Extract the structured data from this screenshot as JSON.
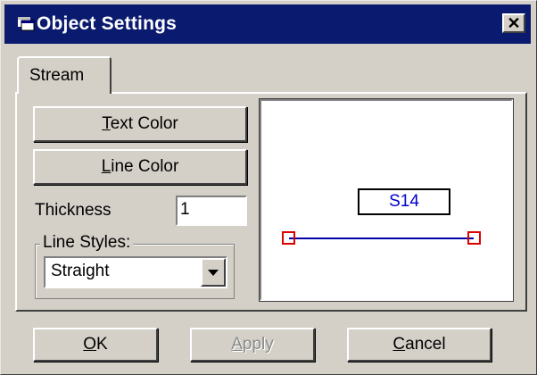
{
  "window": {
    "title": "Object Settings",
    "close_glyph": "✕",
    "icon": "app-window-icon"
  },
  "tabs": [
    {
      "label": "Stream",
      "selected": true
    }
  ],
  "buttons": {
    "text_color": {
      "accel": "T",
      "rest": "ext Color"
    },
    "line_color": {
      "accel": "L",
      "rest": "ine Color"
    }
  },
  "thickness": {
    "label": "Thickness",
    "value": "1"
  },
  "line_styles": {
    "legend": "Line Styles:",
    "selected": "Straight",
    "arrow_icon": "dropdown-arrow-icon"
  },
  "preview": {
    "stream_label": "S14",
    "label_color": "#0000cc",
    "line_color": "#0000aa",
    "endpoint_color": "#dd0000"
  },
  "footer": {
    "ok": {
      "accel": "O",
      "rest": "K"
    },
    "apply": {
      "accel": "A",
      "rest": "pply",
      "disabled": true
    },
    "cancel": {
      "accel": "C",
      "rest": "ancel"
    }
  },
  "colors": {
    "titlebar": "#0a1a6e",
    "face": "#d4d0c8"
  }
}
